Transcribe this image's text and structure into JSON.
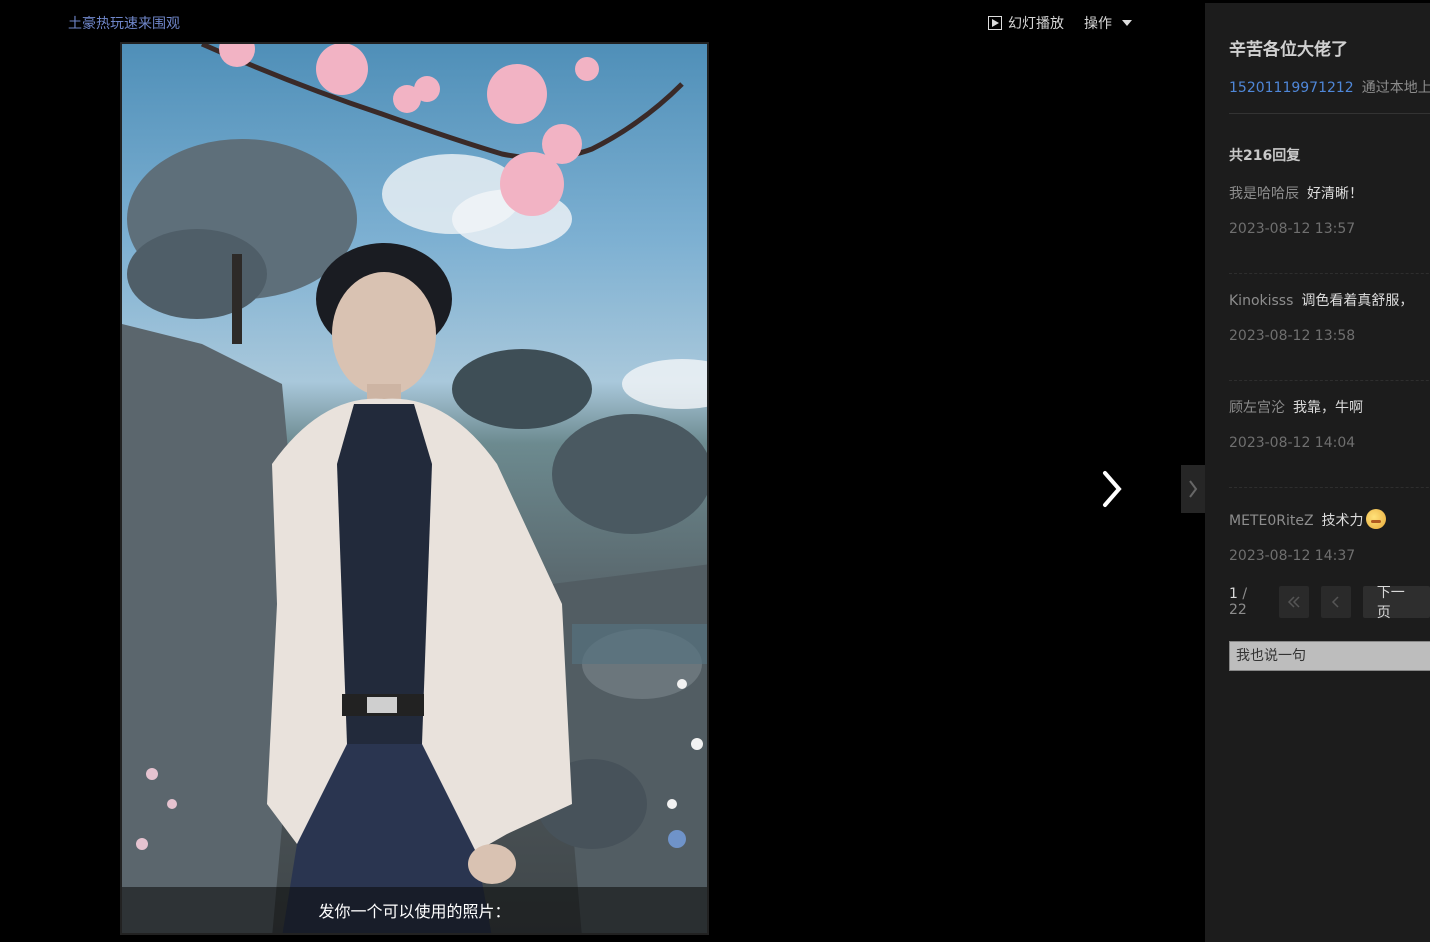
{
  "viewer": {
    "top_link": "土豪热玩速来围观",
    "slideshow_label": "幻灯播放",
    "actions_label": "操作",
    "caption": "发你一个可以使用的照片："
  },
  "sidepanel": {
    "title": "辛苦各位大佬了",
    "author": "15201119971212",
    "via": "通过本地上",
    "reply_count_label": "共216回复",
    "comments": [
      {
        "user": "我是哈哈辰",
        "text": "好清晰！",
        "time": "2023-08-12 13:57"
      },
      {
        "user": "Kinokisss",
        "text": "调色看着真舒服，",
        "time": "2023-08-12 13:58"
      },
      {
        "user": "顾左宫沦",
        "text": "我靠，牛啊",
        "time": "2023-08-12 14:04"
      },
      {
        "user": "METE0RiteZ",
        "text": "技术力",
        "time": "2023-08-12 14:37"
      }
    ],
    "pager": {
      "current": "1",
      "separator": "/",
      "total": "22",
      "next_label": "下一页"
    },
    "reply_placeholder": "我也说一句"
  },
  "colors": {
    "link": "#6f86c9",
    "author": "#4f87d8",
    "panel_bg": "#1c1c1c"
  }
}
